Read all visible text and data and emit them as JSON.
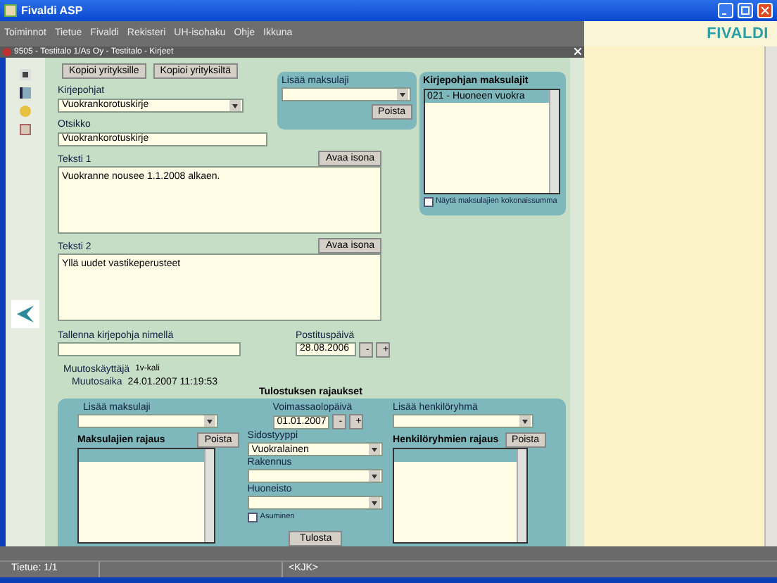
{
  "window": {
    "title": "Fivaldi ASP"
  },
  "menu": [
    "Toiminnot",
    "Tietue",
    "Fivaldi",
    "Rekisteri",
    "UH-isohaku",
    "Ohje",
    "Ikkuna"
  ],
  "logo": "FIVALDI",
  "form_window": {
    "title": "9505 - Testitalo 1/As Oy - Testitalo - Kirjeet"
  },
  "copy_buttons": [
    "Kopioi yrityksille",
    "Kopioi yrityksiltä"
  ],
  "letter_template": {
    "label": "Kirjepohjat",
    "value": "Vuokrankorotuskirje"
  },
  "subject": {
    "label": "Otsikko",
    "value": "Vuokrankorotuskirje"
  },
  "text_fields": [
    {
      "label": "Teksti 1",
      "button": "Avaa isona",
      "value": "Vuokranne nousee 1.1.2008 alkaen."
    },
    {
      "label": "Teksti 2",
      "button": "Avaa isona",
      "value": "Yllä uudet vastikeperusteet"
    }
  ],
  "save_as": {
    "label": "Tallenna kirjepohja nimellä"
  },
  "posting_date": {
    "label": "Postituspäivä",
    "value": "28.08.2006",
    "buttons": [
      "-",
      "+"
    ]
  },
  "modified_by": {
    "label": "Muutoskäyttäjä",
    "value": "1v-kali"
  },
  "modified_at": {
    "label": "Muutosaika",
    "value": "24.01.2007 11:19:53"
  },
  "add_payment_type": {
    "label": "Lisää maksulaji",
    "button": "Poista"
  },
  "template_payment_types": {
    "title": "Kirjepohjan maksulajit",
    "items": [
      {
        "label": "021 - Huoneen vuokra",
        "selected": true
      }
    ],
    "show_total": {
      "label": "Näytä maksulajien kokonaissumma",
      "checked": false
    }
  },
  "print_limits": {
    "title": "Tulostuksen rajaukset",
    "add_payment_type": {
      "label": "Lisää maksulaji"
    },
    "payment_type_limits": {
      "title": "Maksulajien rajaus",
      "button": "Poista"
    },
    "valid_date": {
      "label": "Voimassaolopäivä",
      "value": "01.01.2007",
      "buttons": [
        "-",
        "+"
      ]
    },
    "relation_type": {
      "label": "Sidostyyppi",
      "value": "Vuokralainen"
    },
    "building": {
      "label": "Rakennus"
    },
    "apartment": {
      "label": "Huoneisto"
    },
    "housing": {
      "label": "Asuminen",
      "checked": false
    },
    "print_button": "Tulosta",
    "add_group": {
      "label": "Lisää henkilöryhmä"
    },
    "group_limits": {
      "title": "Henkilöryhmien rajaus",
      "button": "Poista"
    }
  },
  "status_bar": {
    "record": "Tietue: 1/1",
    "mode": "<KJK>"
  }
}
